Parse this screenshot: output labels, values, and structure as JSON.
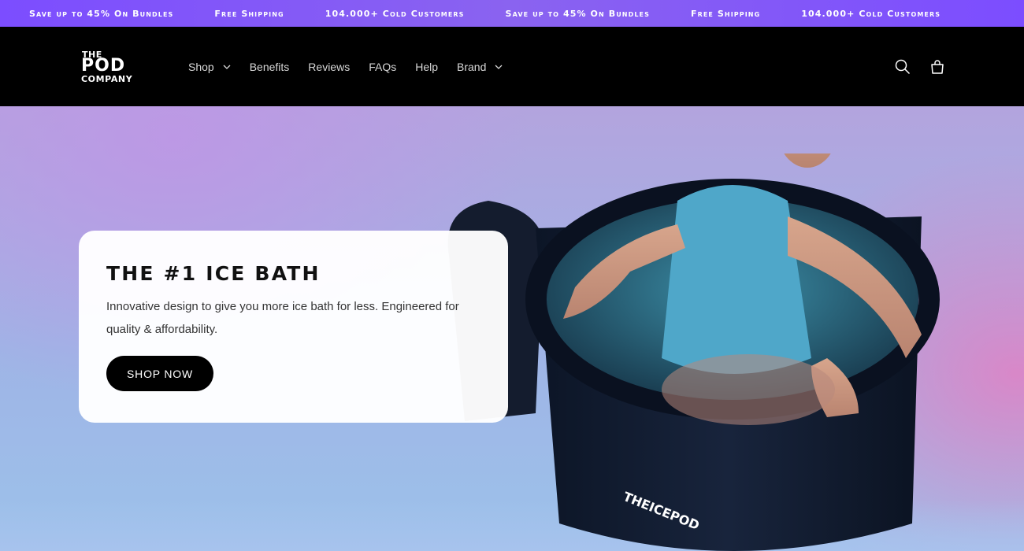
{
  "announcement": {
    "items": [
      "Save up to 45% On Bundles",
      "Free Shipping",
      "104.000+ Cold Customers",
      "Save up to 45% On Bundles",
      "Free Shipping",
      "104.000+ Cold Customers"
    ]
  },
  "logo": {
    "line1": "THE",
    "line2": "POD",
    "line3": "COMPANY"
  },
  "nav": {
    "items": [
      {
        "label": "Shop",
        "has_dropdown": true
      },
      {
        "label": "Benefits",
        "has_dropdown": false
      },
      {
        "label": "Reviews",
        "has_dropdown": false
      },
      {
        "label": "FAQs",
        "has_dropdown": false
      },
      {
        "label": "Help",
        "has_dropdown": false
      },
      {
        "label": "Brand",
        "has_dropdown": true
      }
    ]
  },
  "header_icons": {
    "search": "search-icon",
    "cart": "cart-icon"
  },
  "hero": {
    "title": "THE #1 ICE BATH",
    "text": "Innovative design to give you more ice bath for less. Engineered for quality & affordability.",
    "button": "SHOP NOW",
    "product_brand": "THEICEPOD"
  },
  "colors": {
    "announcement_bg": "#7c4dff",
    "header_bg": "#000000",
    "button_bg": "#000000",
    "card_bg": "#ffffff"
  }
}
